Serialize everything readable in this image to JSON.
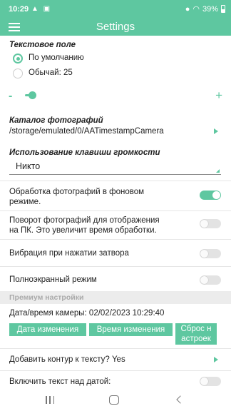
{
  "statusbar": {
    "time": "10:29",
    "left_icons": "▲ ▣",
    "battery": "39%"
  },
  "appbar": {
    "title": "Settings"
  },
  "text_field": {
    "heading": "Текстовое поле",
    "options": [
      {
        "label": "По умолчанию",
        "selected": true
      },
      {
        "label": "Обычай: 25",
        "selected": false
      }
    ],
    "minus": "-",
    "plus": "+"
  },
  "photo_dir": {
    "heading": "Каталог фотографий",
    "path": "/storage/emulated/0/AATimestampCamera"
  },
  "volume_key": {
    "heading": "Использование клавиши громкости",
    "value": "Никто"
  },
  "toggles": [
    {
      "label_lines": [
        "Обработка фотографий в фоновом",
        "режиме."
      ],
      "on": true
    },
    {
      "label_lines": [
        "Поворот фотографий для отображения",
        "на ПК. Это увеличит время обработки."
      ],
      "on": false
    },
    {
      "label_lines": [
        "Вибрация при нажатии затвора"
      ],
      "on": false
    },
    {
      "label_lines": [
        "Полноэкранный режим"
      ],
      "on": false
    }
  ],
  "premium": {
    "header": "Премиум настройки",
    "camera_datetime": "Дата/время камеры: 02/02/2023 10:29:40",
    "buttons": {
      "change_date": "Дата изменения",
      "change_time": "Время изменения",
      "reset_line1": "Сброс н",
      "reset_line2": "астроек"
    },
    "add_outline": "Добавить контур к тексту? Yes",
    "text_above_date": "Включить текст над датой:"
  },
  "colors": {
    "accent": "#5ec7a0",
    "divider": "#e6e6e6",
    "section_bg": "#ececec"
  }
}
